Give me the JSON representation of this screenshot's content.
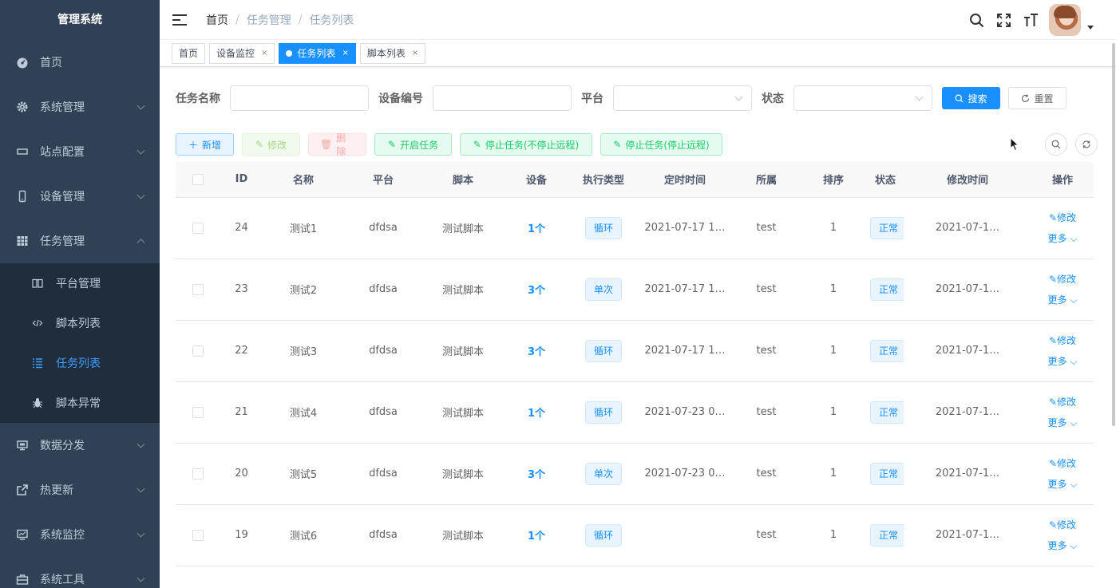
{
  "sidebar": {
    "logo": "管理系统",
    "items": [
      {
        "label": "首页",
        "icon": "dashboard-icon",
        "arrow": false
      },
      {
        "label": "系统管理",
        "icon": "gear-icon",
        "arrow": true
      },
      {
        "label": "站点配置",
        "icon": "monitor-icon",
        "arrow": true
      },
      {
        "label": "设备管理",
        "icon": "phone-icon",
        "arrow": true
      },
      {
        "label": "任务管理",
        "icon": "grid-icon",
        "arrow": "up"
      }
    ],
    "submenu": [
      {
        "label": "平台管理",
        "icon": "book-icon",
        "active": false
      },
      {
        "label": "脚本列表",
        "icon": "code-icon",
        "active": false
      },
      {
        "label": "任务列表",
        "icon": "list-icon",
        "active": true
      },
      {
        "label": "脚本异常",
        "icon": "bug-icon",
        "active": false
      }
    ],
    "items_after": [
      {
        "label": "数据分发",
        "icon": "screen-icon"
      },
      {
        "label": "热更新",
        "icon": "external-link-icon"
      },
      {
        "label": "系统监控",
        "icon": "monitor-chart-icon"
      },
      {
        "label": "系统工具",
        "icon": "toolbox-icon"
      }
    ]
  },
  "navbar": {
    "breadcrumb": [
      "首页",
      "任务管理",
      "任务列表"
    ]
  },
  "tags": [
    {
      "label": "首页",
      "closable": false,
      "active": false
    },
    {
      "label": "设备监控",
      "closable": true,
      "active": false
    },
    {
      "label": "任务列表",
      "closable": true,
      "active": true
    },
    {
      "label": "脚本列表",
      "closable": true,
      "active": false
    }
  ],
  "search": {
    "task_name_label": "任务名称",
    "device_no_label": "设备编号",
    "platform_label": "平台",
    "status_label": "状态",
    "search_button": "搜索",
    "reset_button": "重置"
  },
  "toolbar": {
    "add": "新增",
    "edit": "修改",
    "delete": "删除",
    "start": "开启任务",
    "stop_no_remote": "停止任务(不停止远程)",
    "stop_remote": "停止任务(停止远程)"
  },
  "table": {
    "headers": [
      "ID",
      "名称",
      "平台",
      "脚本",
      "设备",
      "执行类型",
      "定时时间",
      "所属",
      "排序",
      "状态",
      "修改时间",
      "操作"
    ],
    "edit_label": "修改",
    "more_label": "更多",
    "rows": [
      {
        "id": "24",
        "name": "测试1",
        "platform": "dfdsa",
        "script": "测试脚本",
        "device": "1个",
        "type": "循环",
        "timed": "2021-07-17 1…",
        "owner": "test",
        "order": "1",
        "status": "正常",
        "modified": "2021-07-1…"
      },
      {
        "id": "23",
        "name": "测试2",
        "platform": "dfdsa",
        "script": "测试脚本",
        "device": "3个",
        "type": "单次",
        "timed": "2021-07-17 1…",
        "owner": "test",
        "order": "1",
        "status": "正常",
        "modified": "2021-07-1…"
      },
      {
        "id": "22",
        "name": "测试3",
        "platform": "dfdsa",
        "script": "测试脚本",
        "device": "3个",
        "type": "循环",
        "timed": "2021-07-17 1…",
        "owner": "test",
        "order": "1",
        "status": "正常",
        "modified": "2021-07-1…"
      },
      {
        "id": "21",
        "name": "测试4",
        "platform": "dfdsa",
        "script": "测试脚本",
        "device": "1个",
        "type": "循环",
        "timed": "2021-07-23 0…",
        "owner": "test",
        "order": "1",
        "status": "正常",
        "modified": "2021-07-1…"
      },
      {
        "id": "20",
        "name": "测试5",
        "platform": "dfdsa",
        "script": "测试脚本",
        "device": "3个",
        "type": "单次",
        "timed": "2021-07-23 0…",
        "owner": "test",
        "order": "1",
        "status": "正常",
        "modified": "2021-07-1…"
      },
      {
        "id": "19",
        "name": "测试6",
        "platform": "dfdsa",
        "script": "测试脚本",
        "device": "1个",
        "type": "循环",
        "timed": "",
        "owner": "test",
        "order": "1",
        "status": "正常",
        "modified": "2021-07-1…"
      }
    ]
  },
  "colors": {
    "sidebar_bg": "#304156",
    "submenu_bg": "#1f2d3d",
    "accent": "#1890ff"
  }
}
